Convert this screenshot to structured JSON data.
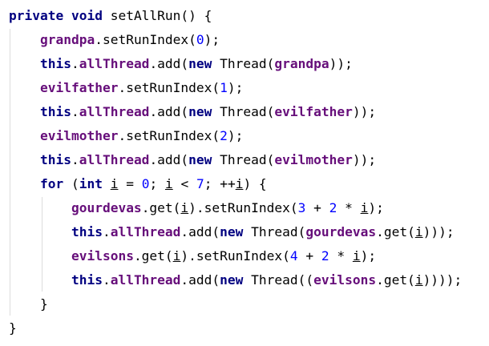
{
  "colors": {
    "background": "#ffffff",
    "keyword": "#000080",
    "field": "#660e7a",
    "number": "#0000ff",
    "plain": "#000000",
    "indent_guide": "#dcdcdc"
  },
  "code": {
    "lines": [
      [
        [
          "kw",
          "private void "
        ],
        [
          "plain",
          "setAllRun() {"
        ]
      ],
      [
        [
          "plain",
          "    "
        ],
        [
          "fld",
          "grandpa"
        ],
        [
          "plain",
          ".setRunIndex("
        ],
        [
          "num",
          "0"
        ],
        [
          "plain",
          ");"
        ]
      ],
      [
        [
          "plain",
          "    "
        ],
        [
          "kw",
          "this"
        ],
        [
          "plain",
          "."
        ],
        [
          "fld",
          "allThread"
        ],
        [
          "plain",
          ".add("
        ],
        [
          "kw",
          "new "
        ],
        [
          "plain",
          "Thread("
        ],
        [
          "fld",
          "grandpa"
        ],
        [
          "plain",
          "));"
        ]
      ],
      [
        [
          "plain",
          "    "
        ],
        [
          "fld",
          "evilfather"
        ],
        [
          "plain",
          ".setRunIndex("
        ],
        [
          "num",
          "1"
        ],
        [
          "plain",
          ");"
        ]
      ],
      [
        [
          "plain",
          "    "
        ],
        [
          "kw",
          "this"
        ],
        [
          "plain",
          "."
        ],
        [
          "fld",
          "allThread"
        ],
        [
          "plain",
          ".add("
        ],
        [
          "kw",
          "new "
        ],
        [
          "plain",
          "Thread("
        ],
        [
          "fld",
          "evilfather"
        ],
        [
          "plain",
          "));"
        ]
      ],
      [
        [
          "plain",
          "    "
        ],
        [
          "fld",
          "evilmother"
        ],
        [
          "plain",
          ".setRunIndex("
        ],
        [
          "num",
          "2"
        ],
        [
          "plain",
          ");"
        ]
      ],
      [
        [
          "plain",
          "    "
        ],
        [
          "kw",
          "this"
        ],
        [
          "plain",
          "."
        ],
        [
          "fld",
          "allThread"
        ],
        [
          "plain",
          ".add("
        ],
        [
          "kw",
          "new "
        ],
        [
          "plain",
          "Thread("
        ],
        [
          "fld",
          "evilmother"
        ],
        [
          "plain",
          "));"
        ]
      ],
      [
        [
          "plain",
          "    "
        ],
        [
          "kw",
          "for "
        ],
        [
          "plain",
          "("
        ],
        [
          "kw",
          "int "
        ],
        [
          "var",
          "i"
        ],
        [
          "plain",
          " = "
        ],
        [
          "num",
          "0"
        ],
        [
          "plain",
          "; "
        ],
        [
          "var",
          "i"
        ],
        [
          "plain",
          " < "
        ],
        [
          "num",
          "7"
        ],
        [
          "plain",
          "; ++"
        ],
        [
          "var",
          "i"
        ],
        [
          "plain",
          ") {"
        ]
      ],
      [
        [
          "plain",
          "        "
        ],
        [
          "fld",
          "gourdevas"
        ],
        [
          "plain",
          ".get("
        ],
        [
          "var",
          "i"
        ],
        [
          "plain",
          ").setRunIndex("
        ],
        [
          "num",
          "3"
        ],
        [
          "plain",
          " + "
        ],
        [
          "num",
          "2"
        ],
        [
          "plain",
          " * "
        ],
        [
          "var",
          "i"
        ],
        [
          "plain",
          ");"
        ]
      ],
      [
        [
          "plain",
          "        "
        ],
        [
          "kw",
          "this"
        ],
        [
          "plain",
          "."
        ],
        [
          "fld",
          "allThread"
        ],
        [
          "plain",
          ".add("
        ],
        [
          "kw",
          "new "
        ],
        [
          "plain",
          "Thread("
        ],
        [
          "fld",
          "gourdevas"
        ],
        [
          "plain",
          ".get("
        ],
        [
          "var",
          "i"
        ],
        [
          "plain",
          ")));"
        ]
      ],
      [
        [
          "plain",
          "        "
        ],
        [
          "fld",
          "evilsons"
        ],
        [
          "plain",
          ".get("
        ],
        [
          "var",
          "i"
        ],
        [
          "plain",
          ").setRunIndex("
        ],
        [
          "num",
          "4"
        ],
        [
          "plain",
          " + "
        ],
        [
          "num",
          "2"
        ],
        [
          "plain",
          " * "
        ],
        [
          "var",
          "i"
        ],
        [
          "plain",
          ");"
        ]
      ],
      [
        [
          "plain",
          "        "
        ],
        [
          "kw",
          "this"
        ],
        [
          "plain",
          "."
        ],
        [
          "fld",
          "allThread"
        ],
        [
          "plain",
          ".add("
        ],
        [
          "kw",
          "new "
        ],
        [
          "plain",
          "Thread(("
        ],
        [
          "fld",
          "evilsons"
        ],
        [
          "plain",
          ".get("
        ],
        [
          "var",
          "i"
        ],
        [
          "plain",
          "))));"
        ]
      ],
      [
        [
          "plain",
          "    }"
        ]
      ],
      [
        [
          "plain",
          "}"
        ]
      ]
    ]
  }
}
